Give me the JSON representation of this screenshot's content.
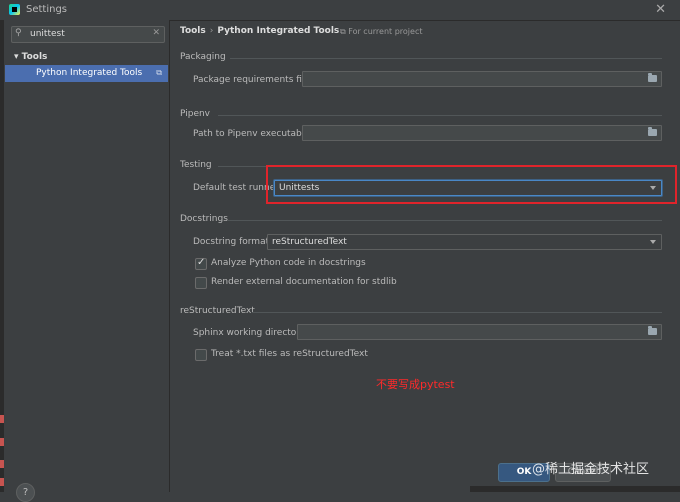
{
  "window": {
    "title": "Settings"
  },
  "sidebar": {
    "search_value": "unittest",
    "group_label": "Tools",
    "selected_item": "Python Integrated Tools"
  },
  "breadcrumb": {
    "root": "Tools",
    "current": "Python Integrated Tools",
    "scope": "For current project"
  },
  "packaging": {
    "title": "Packaging",
    "req_label": "Package requirements file:",
    "req_value": ""
  },
  "pipenv": {
    "title": "Pipenv",
    "path_label": "Path to Pipenv executable:",
    "path_value": ""
  },
  "testing": {
    "title": "Testing",
    "runner_label": "Default test runner:",
    "runner_value": "Unittests"
  },
  "docstrings": {
    "title": "Docstrings",
    "format_label": "Docstring format:",
    "format_value": "reStructuredText",
    "analyze_label": "Analyze Python code in docstrings",
    "analyze_checked": true,
    "render_label": "Render external documentation for stdlib",
    "render_checked": false
  },
  "rest": {
    "title": "reStructuredText",
    "sphinx_label": "Sphinx working directory:",
    "sphinx_value": "",
    "treat_txt_label": "Treat *.txt files as reStructuredText",
    "treat_txt_checked": false
  },
  "annotation": {
    "text": "不要写成pytest",
    "color": "#ff2a2a"
  },
  "footer": {
    "ok_label": "OK",
    "cancel_label": "Cancel",
    "help_label": "?"
  },
  "watermark": {
    "text": "@稀土掘金技术社区"
  },
  "colors": {
    "accent": "#4b6eaf",
    "highlight": "#e0242b",
    "background": "#3c3f41"
  }
}
